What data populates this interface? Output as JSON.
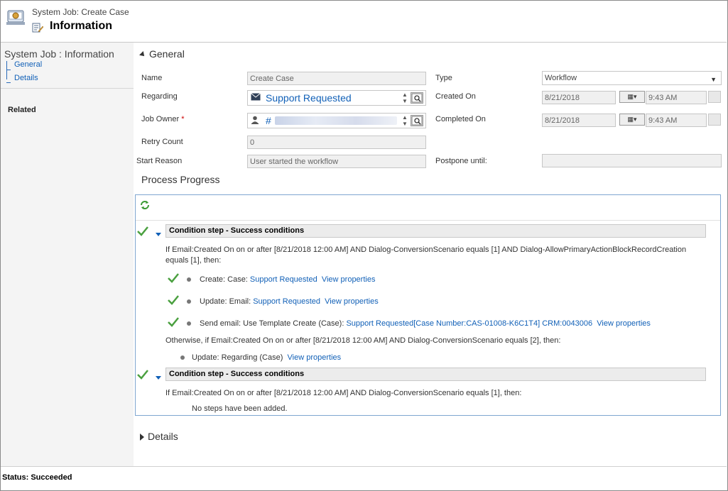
{
  "header": {
    "subtitle": "System Job: Create Case",
    "title": "Information"
  },
  "sidebar": {
    "title": "System Job : Information",
    "items": [
      {
        "label": "General"
      },
      {
        "label": "Details"
      }
    ],
    "related_label": "Related"
  },
  "status": "Status: Succeeded",
  "general": {
    "section_label": "General",
    "name_label": "Name",
    "name_value": "Create Case",
    "regarding_label": "Regarding",
    "regarding_value": "Support Requested",
    "job_owner_label": "Job Owner",
    "job_owner_required": "*",
    "job_owner_value": "#",
    "retry_count_label": "Retry Count",
    "retry_count_value": "0",
    "start_reason_label": "Start Reason",
    "start_reason_value": "User started the workflow",
    "type_label": "Type",
    "type_value": "Workflow",
    "created_on_label": "Created On",
    "created_on_date": "8/21/2018",
    "created_on_time": "9:43 AM",
    "completed_on_label": "Completed On",
    "completed_on_date": "8/21/2018",
    "completed_on_time": "9:43 AM",
    "postpone_label": "Postpone until:",
    "postpone_value": ""
  },
  "process": {
    "heading": "Process Progress",
    "steps": [
      {
        "title": "Condition step - Success conditions",
        "condition": "If Email:Created On on or after [8/21/2018 12:00 AM] AND Dialog-ConversionScenario equals [1] AND Dialog-AllowPrimaryActionBlockRecordCreation equals [1], then:",
        "actions": [
          {
            "prefix": "Create:  Case: ",
            "link": "Support Requested",
            "props": "View properties"
          },
          {
            "prefix": "Update:  Email: ",
            "link": "Support Requested",
            "props": "View properties"
          },
          {
            "prefix": "Send email:  Use Template  Create (Case): ",
            "link": "Support Requested[Case Number:CAS-01008-K6C1T4] CRM:0043006",
            "props": "View properties"
          }
        ],
        "otherwise": "Otherwise, if Email:Created On on or after [8/21/2018 12:00 AM] AND Dialog-ConversionScenario equals [2], then:",
        "otherwise_action": {
          "prefix": "Update:  Regarding (Case) ",
          "props": "View properties"
        }
      },
      {
        "title": "Condition step - Success conditions",
        "condition": "If Email:Created On on or after [8/21/2018 12:00 AM] AND Dialog-ConversionScenario equals [1], then:",
        "empty": "No steps have been added."
      }
    ]
  },
  "details": {
    "section_label": "Details"
  },
  "colors": {
    "link": "#1160b7",
    "check": "#4aa03f",
    "panel_border": "#7fa6d0"
  },
  "icons": [
    "system-job-icon",
    "form-edit-icon",
    "refresh-icon",
    "check-icon",
    "mail-icon",
    "user-icon",
    "lookup-icon",
    "calendar-icon"
  ]
}
